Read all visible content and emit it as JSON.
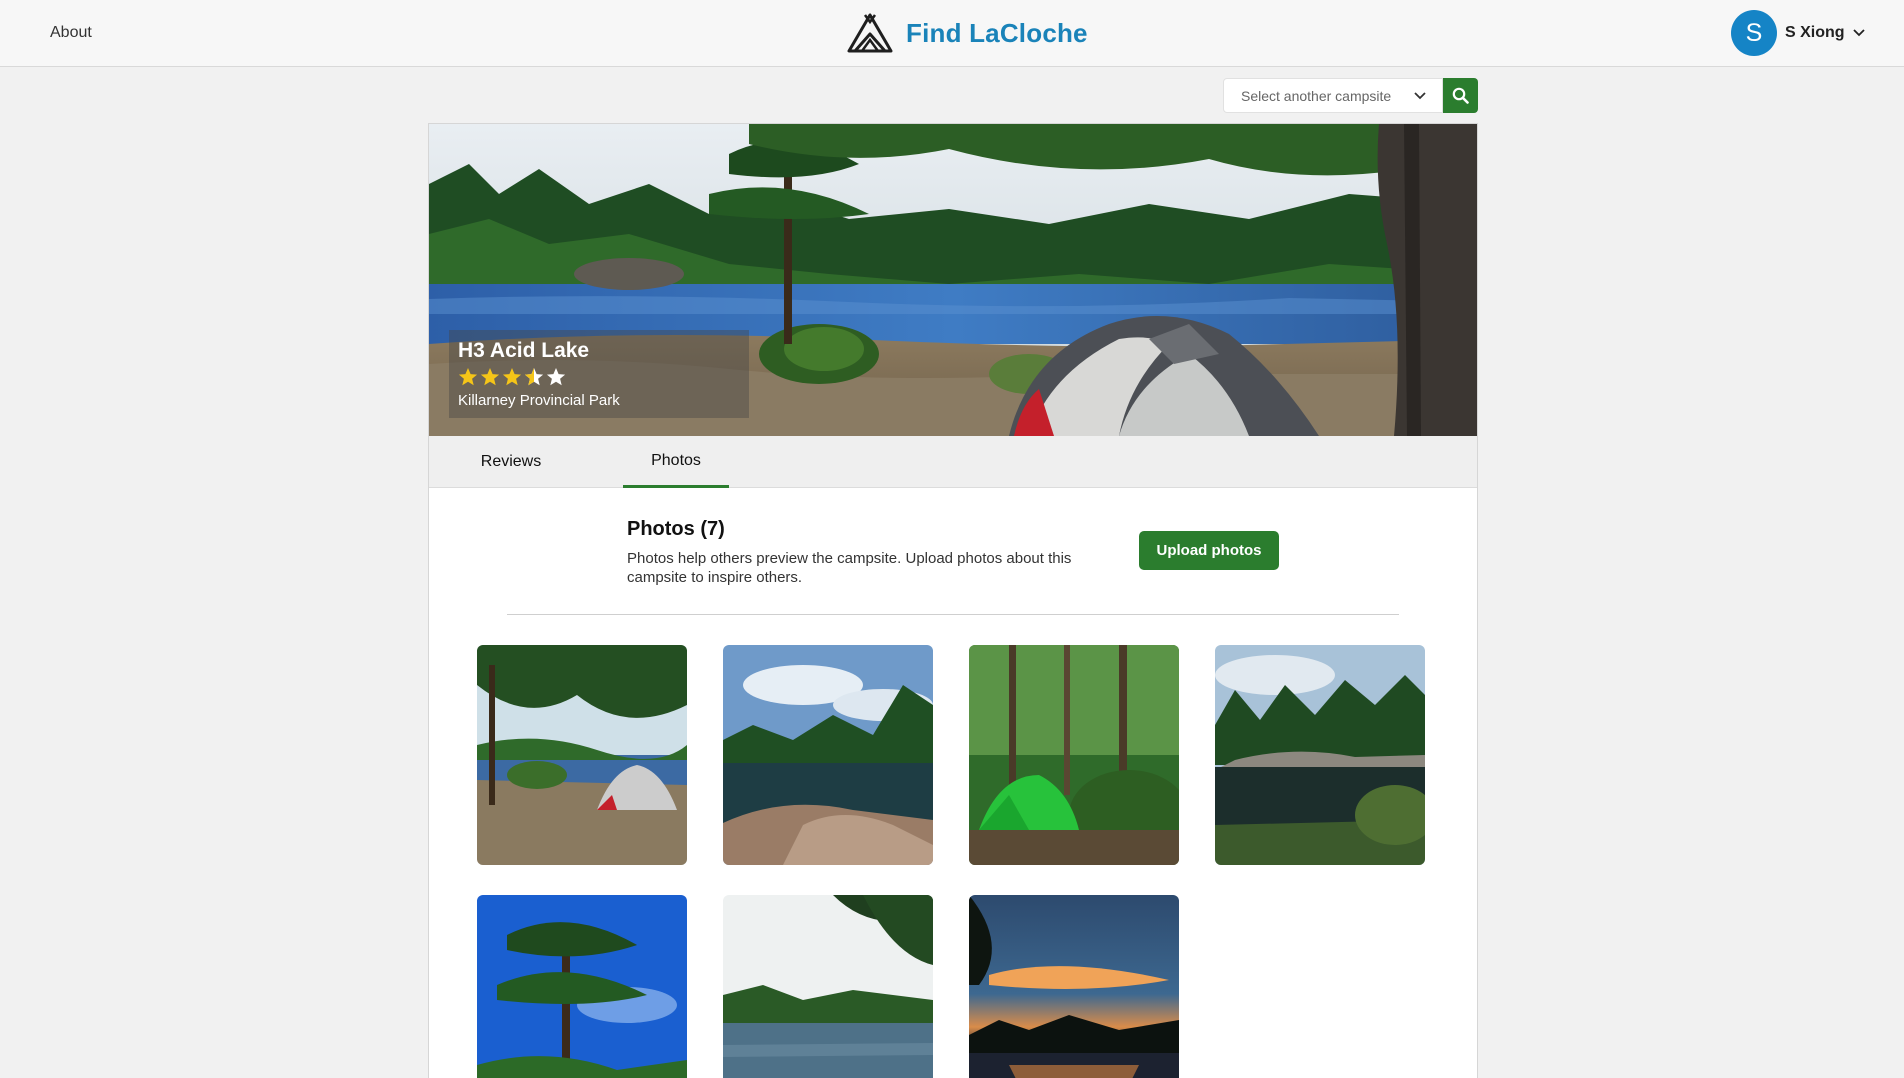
{
  "nav": {
    "about_label": "About",
    "brand_name": "Find LaCloche",
    "user": {
      "initial": "S",
      "name": "S Xiong"
    }
  },
  "search": {
    "placeholder": "Select another campsite"
  },
  "campsite": {
    "name": "H3 Acid Lake",
    "park": "Killarney Provincial Park",
    "rating": 3.5,
    "rating_max": 5
  },
  "tabs": [
    {
      "label": "Reviews",
      "active": false
    },
    {
      "label": "Photos",
      "active": true
    }
  ],
  "photos_section": {
    "title": "Photos (7)",
    "description": "Photos help others preview the campsite. Upload photos about this campsite to inspire others.",
    "upload_label": "Upload photos",
    "photos": [
      {
        "subject": "lakeside tent under pines"
      },
      {
        "subject": "calm lake with rocky shore"
      },
      {
        "subject": "green tent in forest"
      },
      {
        "subject": "forested lake reflection"
      },
      {
        "subject": "tall pine against blue sky"
      },
      {
        "subject": "pine branches over lake"
      },
      {
        "subject": "sunset over lake"
      }
    ]
  },
  "colors": {
    "brand_blue": "#1a83b9",
    "accent_green": "#2b7d2e",
    "avatar_blue": "#1584c6",
    "star_yellow": "#f5c518"
  },
  "icons": {
    "logo": "tent-logo-icon",
    "search": "search-icon",
    "dropdown": "chevron-down-icon",
    "rating": "star-icon"
  }
}
